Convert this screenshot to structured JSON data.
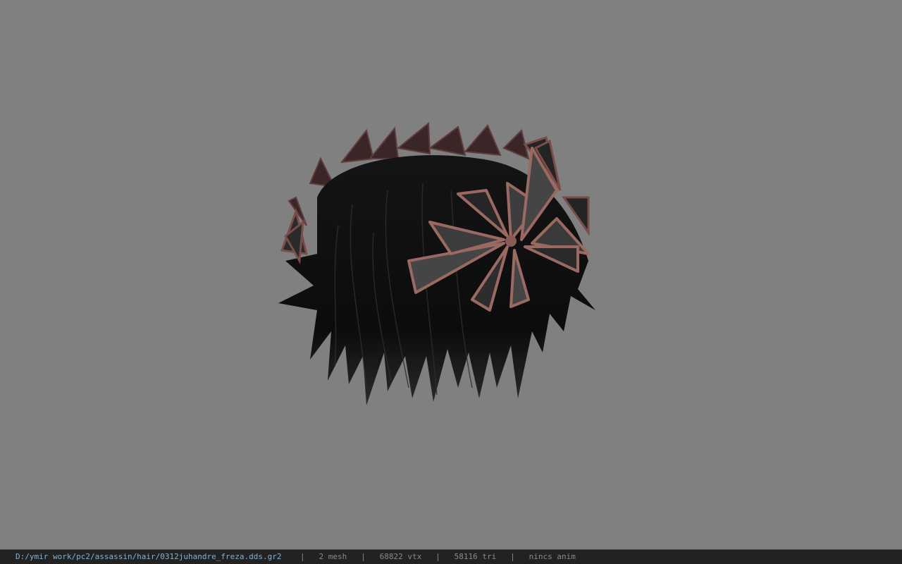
{
  "viewport": {
    "background": "#808080",
    "model_name": "hair-with-flower-crown"
  },
  "status": {
    "file_path": "D:/ymir work/pc2/assassin/hair/0312juhandre_freza.dds.gr2",
    "sep1": "|",
    "mesh_count": "2 mesh",
    "sep2": "|",
    "vertex_count": "68822 vtx",
    "sep3": "|",
    "triangle_count": "58116 tri",
    "sep4": "|",
    "anim_status": "nincs anim"
  }
}
